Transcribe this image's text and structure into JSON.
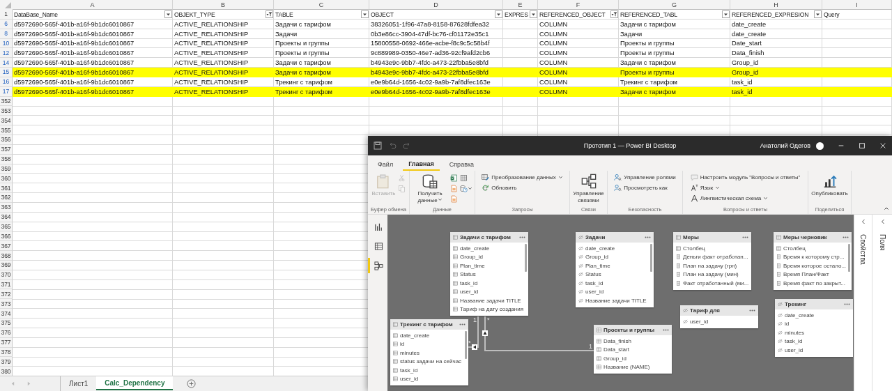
{
  "spreadsheet": {
    "column_letters": [
      "A",
      "B",
      "C",
      "D",
      "E",
      "F",
      "G",
      "H",
      "I"
    ],
    "header_row": {
      "number": "1",
      "cells": [
        {
          "text": "DataBase_Name",
          "filter_button": true,
          "filter_applied": false
        },
        {
          "text": "OBJEKT_TYPE",
          "filter_button": true,
          "filter_applied": true
        },
        {
          "text": "TABLE",
          "filter_button": true,
          "filter_applied": false
        },
        {
          "text": "OBJECT",
          "filter_button": true,
          "filter_applied": false
        },
        {
          "text": "EXPRES",
          "filter_button": true,
          "filter_applied": false
        },
        {
          "text": "REFERENCED_OBJECT",
          "filter_button": true,
          "filter_applied": true
        },
        {
          "text": "REFERENCED_TABL",
          "filter_button": true,
          "filter_applied": false
        },
        {
          "text": "REFERENCED_EXPRESION",
          "filter_button": true,
          "filter_applied": false
        },
        {
          "text": "Query",
          "filter_button": false
        }
      ]
    },
    "rows": [
      {
        "number": "6",
        "filtered": true,
        "highlighted": false,
        "database": "d5972690-565f-401b-a16f-9b1dc6010867",
        "objekt_type": "ACTIVE_RELATIONSHIP",
        "table": "Задачи с тарифом",
        "object": "38326051-1f96-47a8-8158-87628fdfea32",
        "referenced_object": "COLUMN",
        "referenced_table": "Задачи с тарифом",
        "referenced_expression": "date_create"
      },
      {
        "number": "8",
        "filtered": true,
        "highlighted": false,
        "database": "d5972690-565f-401b-a16f-9b1dc6010867",
        "objekt_type": "ACTIVE_RELATIONSHIP",
        "table": "Задачи",
        "object": "0b3e86cc-3904-47df-bc76-cf01172e35c1",
        "referenced_object": "COLUMN",
        "referenced_table": "Задачи",
        "referenced_expression": "date_create"
      },
      {
        "number": "10",
        "filtered": true,
        "highlighted": false,
        "database": "d5972690-565f-401b-a16f-9b1dc6010867",
        "objekt_type": "ACTIVE_RELATIONSHIP",
        "table": "Проекты и группы",
        "object": "15800558-0692-466e-acbe-f8c9c5c58b4f",
        "referenced_object": "COLUMN",
        "referenced_table": "Проекты и группы",
        "referenced_expression": "Date_start"
      },
      {
        "number": "12",
        "filtered": true,
        "highlighted": false,
        "database": "d5972690-565f-401b-a16f-9b1dc6010867",
        "objekt_type": "ACTIVE_RELATIONSHIP",
        "table": "Проекты и группы",
        "object": "9c889989-0350-46e7-ad36-92cf9afd2cb6",
        "referenced_object": "COLUMN",
        "referenced_table": "Проекты и группы",
        "referenced_expression": "Data_finish"
      },
      {
        "number": "14",
        "filtered": true,
        "highlighted": false,
        "database": "d5972690-565f-401b-a16f-9b1dc6010867",
        "objekt_type": "ACTIVE_RELATIONSHIP",
        "table": "Задачи с тарифом",
        "object": "b4943e9c-9bb7-4fdc-a473-22fbba5e8bfd",
        "referenced_object": "COLUMN",
        "referenced_table": "Задачи с тарифом",
        "referenced_expression": "Group_id"
      },
      {
        "number": "15",
        "filtered": true,
        "highlighted": true,
        "database": "d5972690-565f-401b-a16f-9b1dc6010867",
        "objekt_type": "ACTIVE_RELATIONSHIP",
        "table": "Задачи с тарифом",
        "object": "b4943e9c-9bb7-4fdc-a473-22fbba5e8bfd",
        "referenced_object": "COLUMN",
        "referenced_table": "Проекты и группы",
        "referenced_expression": "Group_id"
      },
      {
        "number": "16",
        "filtered": true,
        "highlighted": false,
        "database": "d5972690-565f-401b-a16f-9b1dc6010867",
        "objekt_type": "ACTIVE_RELATIONSHIP",
        "table": "Трекинг с тарифом",
        "object": "e0e9b64d-1656-4c02-9a9b-7af8dfec163e",
        "referenced_object": "COLUMN",
        "referenced_table": "Трекинг с тарифом",
        "referenced_expression": "task_id"
      },
      {
        "number": "17",
        "filtered": true,
        "highlighted": true,
        "database": "d5972690-565f-401b-a16f-9b1dc6010867",
        "objekt_type": "ACTIVE_RELATIONSHIP",
        "table": "Трекинг с тарифом",
        "object": "e0e9b64d-1656-4c02-9a9b-7af8dfec163e",
        "referenced_object": "COLUMN",
        "referenced_table": "Задачи с тарифом",
        "referenced_expression": "task_id"
      }
    ],
    "empty_rows": [
      "352",
      "353",
      "354",
      "355",
      "356",
      "357",
      "358",
      "359",
      "360",
      "361",
      "362",
      "363",
      "364",
      "365",
      "366",
      "367",
      "368",
      "369",
      "370",
      "371",
      "372",
      "373",
      "374",
      "375",
      "376",
      "377",
      "378",
      "379",
      "380"
    ]
  },
  "sheet_tabs": [
    {
      "label": "Лист1",
      "selected": false
    },
    {
      "label": "Calc_Dependency",
      "selected": true
    }
  ],
  "powerbi": {
    "title": "Прототип 1 — Power BI Desktop",
    "user": "Анатолий Одегов",
    "ribbon_tabs": [
      {
        "label": "Файл",
        "selected": false
      },
      {
        "label": "Главная",
        "selected": true
      },
      {
        "label": "Справка",
        "selected": false
      }
    ],
    "ribbon_groups": [
      {
        "label": "Буфер обмена",
        "items": [
          {
            "kind": "large",
            "label": "Вставить",
            "disabled": true,
            "dropdown": false
          },
          {
            "kind": "icon",
            "disabled": true,
            "dropdown": false
          },
          {
            "kind": "icon",
            "disabled": true,
            "dropdown": false
          }
        ]
      },
      {
        "label": "Данные",
        "items": [
          {
            "kind": "large",
            "label": "Получить данные",
            "disabled": false,
            "dropdown": true
          },
          {
            "kind": "icon",
            "disabled": false,
            "dropdown": false
          },
          {
            "kind": "icon",
            "disabled": false,
            "dropdown": false
          },
          {
            "kind": "icon",
            "disabled": false,
            "dropdown": false
          },
          {
            "kind": "icon",
            "disabled": false,
            "dropdown": false
          },
          {
            "kind": "icon",
            "disabled": false,
            "dropdown": true
          }
        ]
      },
      {
        "label": "Запросы",
        "items": [
          {
            "kind": "small",
            "label": "Преобразование данных",
            "disabled": false,
            "dropdown": true
          },
          {
            "kind": "small",
            "label": "Обновить",
            "disabled": false,
            "dropdown": false
          }
        ]
      },
      {
        "label": "Связи",
        "items": [
          {
            "kind": "large",
            "label": "Управление связями",
            "disabled": false,
            "dropdown": false
          }
        ]
      },
      {
        "label": "Безопасность",
        "items": [
          {
            "kind": "small",
            "label": "Управление ролями",
            "disabled": false,
            "dropdown": false
          },
          {
            "kind": "small",
            "label": "Просмотреть как",
            "disabled": false,
            "dropdown": false
          }
        ]
      },
      {
        "label": "Вопросы и ответы",
        "items": [
          {
            "kind": "small",
            "label": "Настроить модуль \"Вопросы и ответы\"",
            "disabled": false,
            "dropdown": false
          },
          {
            "kind": "small",
            "label": "Язык",
            "disabled": false,
            "dropdown": true
          },
          {
            "kind": "small",
            "label": "Лингвистическая схема",
            "disabled": false,
            "dropdown": true
          }
        ]
      },
      {
        "label": "Поделиться",
        "items": [
          {
            "kind": "large",
            "label": "Опубликовать",
            "disabled": false,
            "dropdown": false
          }
        ]
      }
    ],
    "views": [
      {
        "selected": false
      },
      {
        "selected": false
      },
      {
        "selected": true
      }
    ],
    "panes": [
      "Свойства",
      "Поля"
    ],
    "model": {
      "tables": [
        {
          "name": "Задачи с тарифом",
          "hidden": false,
          "fields": [
            {
              "name": "date_create",
              "kind": "column"
            },
            {
              "name": "Group_id",
              "kind": "column"
            },
            {
              "name": "Plan_time",
              "kind": "column"
            },
            {
              "name": "Status",
              "kind": "column"
            },
            {
              "name": "task_id",
              "kind": "column"
            },
            {
              "name": "user_id",
              "kind": "column"
            },
            {
              "name": "Название задачи TITLE",
              "kind": "column"
            },
            {
              "name": "Тариф на дату создания",
              "kind": "column"
            }
          ]
        },
        {
          "name": "Задачи",
          "hidden": true,
          "fields": [
            {
              "name": "date_create"
            },
            {
              "name": "Group_id"
            },
            {
              "name": "Plan_time"
            },
            {
              "name": "Status"
            },
            {
              "name": "task_id"
            },
            {
              "name": "user_id"
            },
            {
              "name": "Название задачи TITLE"
            }
          ]
        },
        {
          "name": "Меры",
          "hidden": false,
          "fields": [
            {
              "name": "Столбец",
              "kind": "column"
            },
            {
              "name": "Деньги факт отработан...",
              "kind": "measure"
            },
            {
              "name": "План на задачу (грн)",
              "kind": "measure"
            },
            {
              "name": "План на задачу (мин)",
              "kind": "measure"
            },
            {
              "name": "Факт отработанный (ми...",
              "kind": "measure"
            }
          ]
        },
        {
          "name": "Меры черновик",
          "hidden": false,
          "fields": [
            {
              "name": "Столбец",
              "kind": "column"
            },
            {
              "name": "Время к которому стр...",
              "kind": "measure"
            },
            {
              "name": "Время которое остало...",
              "kind": "measure"
            },
            {
              "name": "Время План/Факт",
              "kind": "measure"
            },
            {
              "name": "Время факт по закрыт...",
              "kind": "measure"
            }
          ]
        },
        {
          "name": "Тариф для",
          "hidden": true,
          "fields": [
            {
              "name": "user_id"
            }
          ]
        },
        {
          "name": "Трекинг",
          "hidden": true,
          "fields": [
            {
              "name": "date_create"
            },
            {
              "name": "id"
            },
            {
              "name": "minutes"
            },
            {
              "name": "task_id"
            },
            {
              "name": "user_id"
            }
          ]
        },
        {
          "name": "Трекинг с тарифом",
          "hidden": false,
          "fields": [
            {
              "name": "date_create",
              "kind": "column"
            },
            {
              "name": "id",
              "kind": "column"
            },
            {
              "name": "minutes",
              "kind": "column"
            },
            {
              "name": "status задачи на сейчас",
              "kind": "column"
            },
            {
              "name": "task_id",
              "kind": "column"
            },
            {
              "name": "user_id",
              "kind": "column"
            }
          ]
        },
        {
          "name": "Проекты и группы",
          "hidden": false,
          "fields": [
            {
              "name": "Data_finish",
              "kind": "column"
            },
            {
              "name": "Data_start",
              "kind": "column"
            },
            {
              "name": "Group_id",
              "kind": "column"
            },
            {
              "name": "Название (NAME)",
              "kind": "column"
            }
          ]
        }
      ],
      "relationships": [
        {
          "from_end": "1",
          "to_end": "*"
        },
        {
          "from_end": "*",
          "to_end": "1"
        }
      ]
    }
  }
}
